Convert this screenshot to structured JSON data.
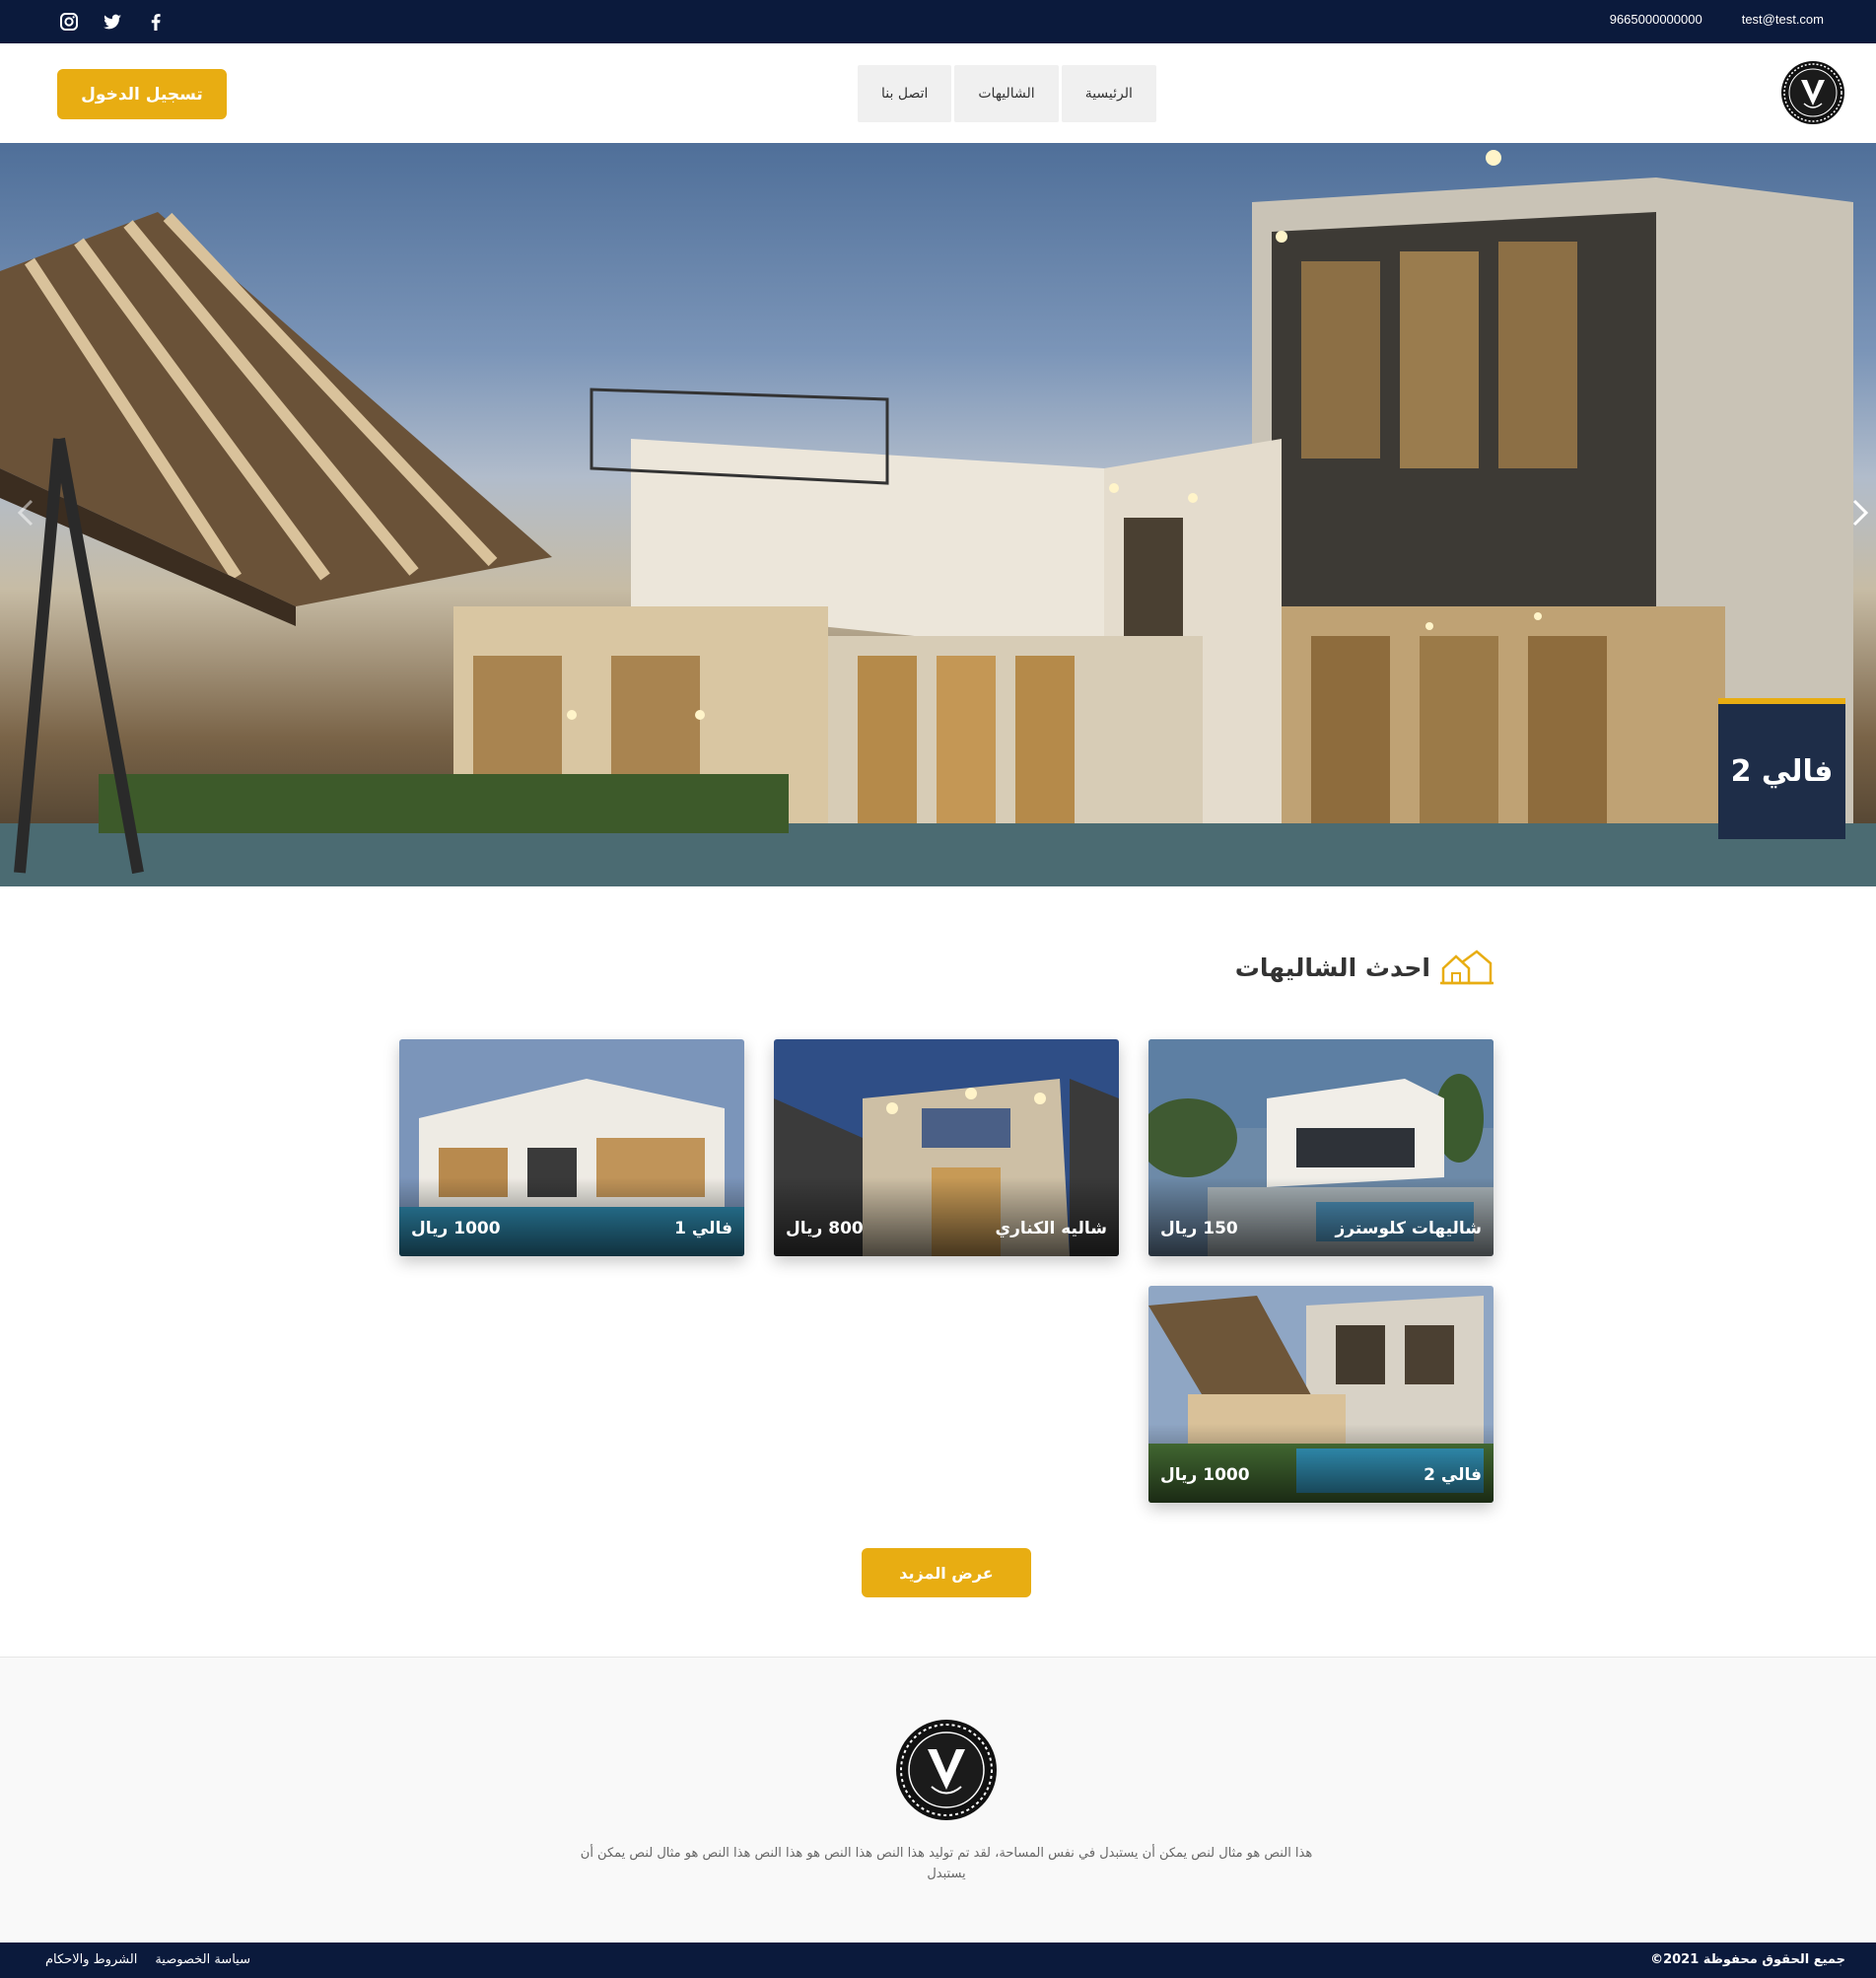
{
  "topbar": {
    "social_icons": [
      "instagram-icon",
      "twitter-icon",
      "facebook-icon"
    ],
    "phone": "9665000000000",
    "email": "test@test.com"
  },
  "header": {
    "login_label": "تسجيل الدخول",
    "nav": [
      {
        "label": "الرئيسية"
      },
      {
        "label": "الشاليهات"
      },
      {
        "label": "اتصل بنا"
      }
    ],
    "logo_icon": "v-logo-icon"
  },
  "hero": {
    "caption": "فالي 2",
    "prev_icon": "chevron-left-icon",
    "next_icon": "chevron-right-icon"
  },
  "latest": {
    "title": "احدث الشاليهات",
    "title_icon": "houses-icon",
    "cards": [
      {
        "name": "شاليهات كلوسترز",
        "price": "150 ريال"
      },
      {
        "name": "شاليه الكناري",
        "price": "800 ريال"
      },
      {
        "name": "فالي 1",
        "price": "1000 ريال"
      },
      {
        "name": "فالي 2",
        "price": "1000 ريال"
      }
    ],
    "more_label": "عرض المزيد"
  },
  "footer": {
    "text": "هذا النص هو مثال لنص يمكن أن يستبدل في نفس المساحة، لقد تم توليد هذا النص هذا النص هو هذا النص هذا النص هو مثال لنص يمكن أن يستبدل",
    "copyright": "جميع الحقوق محفوظة 2021©",
    "links": [
      {
        "label": "سياسة الخصوصية"
      },
      {
        "label": "الشروط والاحكام"
      }
    ]
  },
  "colors": {
    "navy": "#0b1a3c",
    "accent": "#e8ad12",
    "caption_bg": "#1e2d48"
  }
}
